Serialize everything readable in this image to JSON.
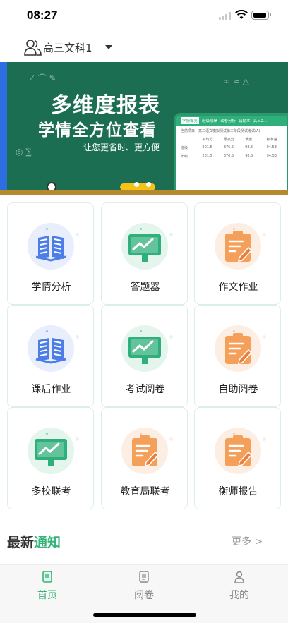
{
  "status_bar": {
    "time": "08:27",
    "icons": [
      "cellular-signal-icon",
      "wifi-icon",
      "battery-icon"
    ]
  },
  "header": {
    "class_name": "高三文科1",
    "class_icon": "users-icon",
    "dropdown_icon": "triangle-down-icon"
  },
  "banner": {
    "title": "多维度报表",
    "subtitle": "学情全方位查看",
    "caption": "让您更省时、更方便",
    "phone_tabs": [
      "学情概览",
      "班级成绩",
      "试卷分析",
      "错题本",
      "高三2..."
    ],
    "phone_meta": "当前项目：高三语文模拟测试第三阶段测试考试(A)",
    "phone_header": [
      "平均分",
      "最高分",
      "难度",
      "标准差"
    ],
    "phone_rows": [
      {
        "name": "班级",
        "values": [
          "201.5",
          "376.5",
          "98.5",
          "94.53"
        ]
      },
      {
        "name": "年级",
        "values": [
          "201.5",
          "376.5",
          "98.5",
          "94.53"
        ]
      }
    ],
    "colors": {
      "background": "#1c6e52",
      "accent_strip": "#2d6ee0",
      "phone_border": "#2a9a6c"
    },
    "carousel_total": 2
  },
  "grid": {
    "items": [
      {
        "label": "学情分析",
        "icon": "open-book-icon",
        "color": "#e8eefc",
        "accent": "#4d7ee8"
      },
      {
        "label": "答题器",
        "icon": "chart-board-icon",
        "color": "#e3f5ec",
        "accent": "#2fb07a"
      },
      {
        "label": "作文作业",
        "icon": "clipboard-pencil-icon",
        "color": "#fdeee3",
        "accent": "#f4a05a"
      },
      {
        "label": "课后作业",
        "icon": "open-book-icon",
        "color": "#e8eefc",
        "accent": "#4d7ee8"
      },
      {
        "label": "考试阅卷",
        "icon": "chart-board-icon",
        "color": "#e3f5ec",
        "accent": "#2fb07a"
      },
      {
        "label": "自助阅卷",
        "icon": "clipboard-pencil-icon",
        "color": "#fdeee3",
        "accent": "#f4a05a"
      },
      {
        "label": "多校联考",
        "icon": "chart-board-icon",
        "color": "#e3f5ec",
        "accent": "#2fb07a"
      },
      {
        "label": "教育局联考",
        "icon": "clipboard-pencil-icon",
        "color": "#fdeee3",
        "accent": "#f4a05a"
      },
      {
        "label": "衡师报告",
        "icon": "clipboard-pencil-icon",
        "color": "#fdeee3",
        "accent": "#f4a05a"
      }
    ]
  },
  "news": {
    "title_prefix": "最新",
    "title_highlight": "通知",
    "more_label": "更多 >"
  },
  "tabbar": {
    "tabs": [
      {
        "label": "首页",
        "icon": "home-doc-icon",
        "active": true
      },
      {
        "label": "阅卷",
        "icon": "grading-doc-icon",
        "active": false
      },
      {
        "label": "我的",
        "icon": "user-icon",
        "active": false
      }
    ],
    "active_color": "#38b37b"
  }
}
